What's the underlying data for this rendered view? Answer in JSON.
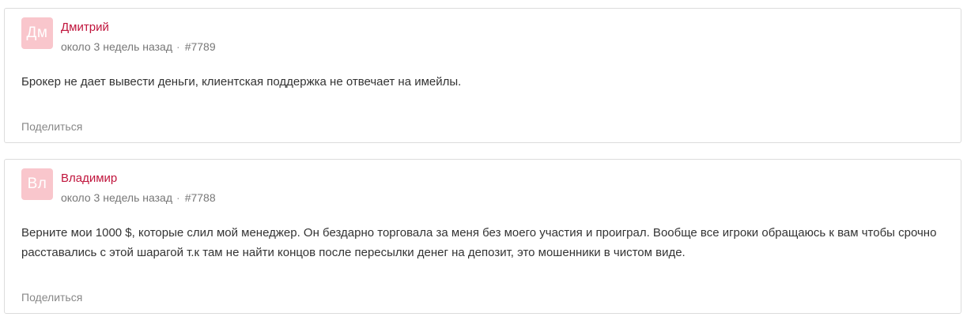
{
  "comments": [
    {
      "avatar_initials": "Дм",
      "author": "Дмитрий",
      "time": "около 3 недель назад",
      "separator": "·",
      "number": "#7789",
      "text": "Брокер не дает вывести деньги, клиентская поддержка не отвечает на имейлы.",
      "share_label": "Поделиться"
    },
    {
      "avatar_initials": "Вл",
      "author": "Владимир",
      "time": "около 3 недель назад",
      "separator": "·",
      "number": "#7788",
      "text": "Верните мои 1000 $, которые слил мой менеджер. Он бездарно торговала за меня без моего участия и проиграл. Вообще все игроки обращаюсь к вам чтобы срочно расставались с этой шарагой т.к там не найти концов после пересылки денег на депозит, это мошенники в чистом виде.",
      "share_label": "Поделиться"
    }
  ],
  "colors": {
    "avatar_bg": "#f9c6cc",
    "author": "#c0143c",
    "border": "#dcdcdc"
  }
}
